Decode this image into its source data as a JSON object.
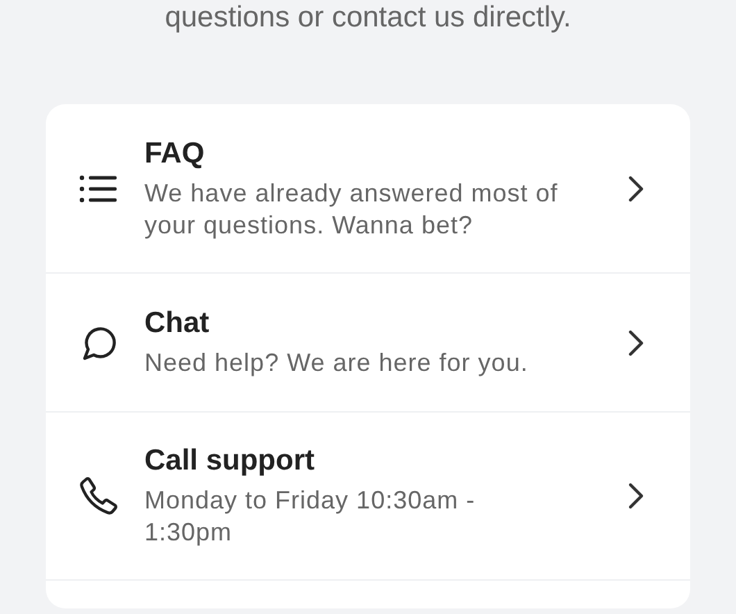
{
  "intro": "questions or contact us directly.",
  "options": [
    {
      "kind": "faq",
      "title": "FAQ",
      "subtitle": "We have already answered most of your questions. Wanna bet?"
    },
    {
      "kind": "chat",
      "title": "Chat",
      "subtitle": "Need help? We are here for you."
    },
    {
      "kind": "call",
      "title": "Call support",
      "subtitle": "Monday to Friday 10:30am - 1:30pm"
    }
  ]
}
